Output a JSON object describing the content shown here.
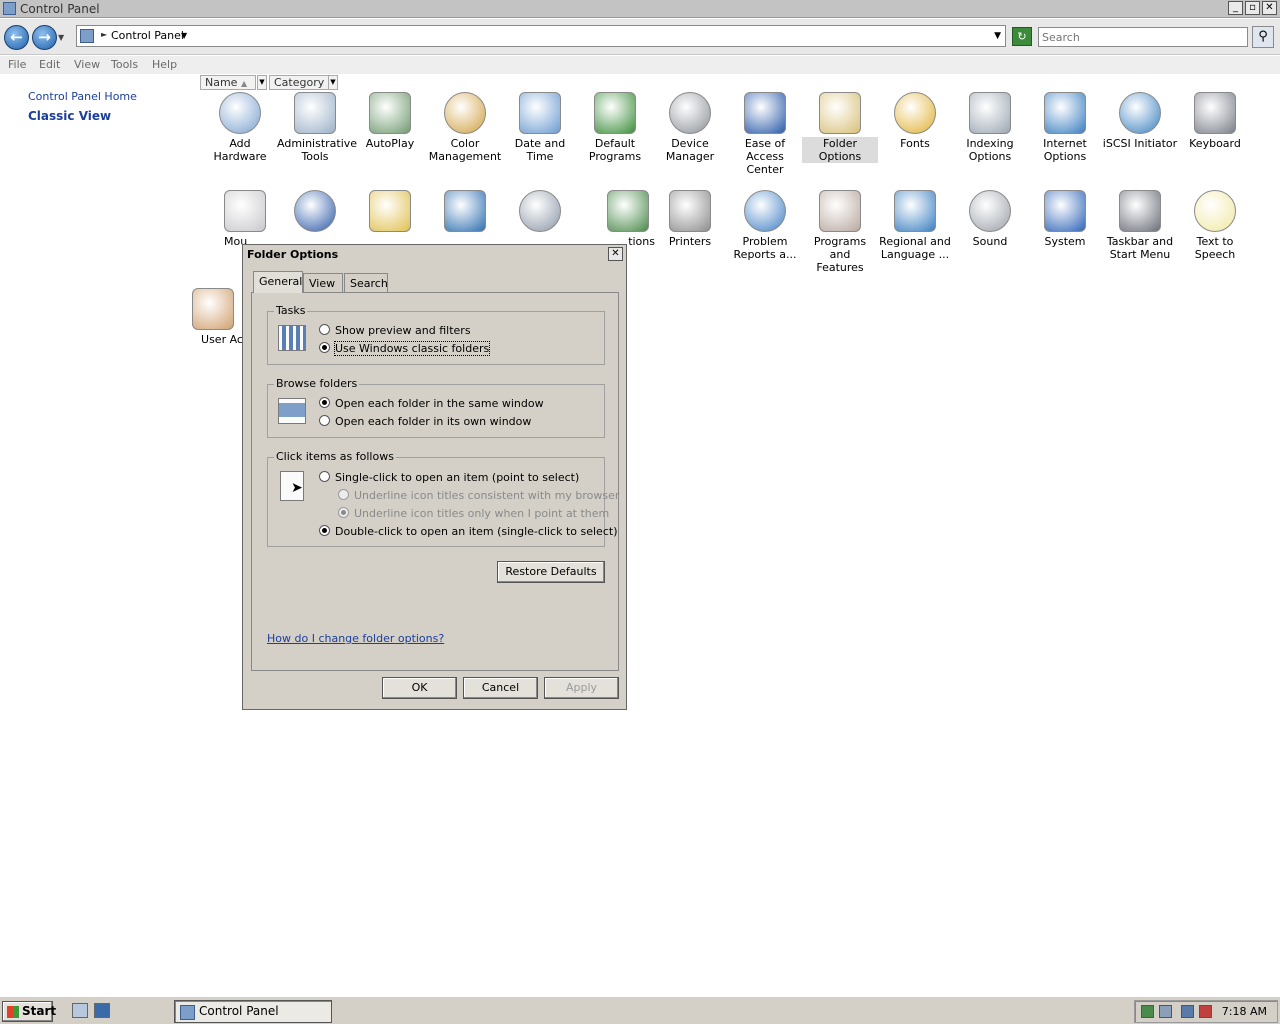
{
  "window": {
    "title": "Control Panel",
    "min": "_",
    "max": "▫",
    "close": "✕"
  },
  "address": {
    "path": "Control Panel",
    "search_placeholder": "Search"
  },
  "menu": [
    "File",
    "Edit",
    "View",
    "Tools",
    "Help"
  ],
  "leftpane": {
    "home": "Control Panel Home",
    "classic": "Classic View"
  },
  "columns": {
    "name": "Name",
    "category": "Category"
  },
  "items": [
    {
      "label": "Add Hardware",
      "icon": "add-hardware-icon"
    },
    {
      "label": "Administrative\nTools",
      "icon": "administrative-tools-icon"
    },
    {
      "label": "AutoPlay",
      "icon": "autoplay-icon"
    },
    {
      "label": "Color\nManagement",
      "icon": "color-management-icon"
    },
    {
      "label": "Date and Time",
      "icon": "date-time-icon"
    },
    {
      "label": "Default\nPrograms",
      "icon": "default-programs-icon"
    },
    {
      "label": "Device\nManager",
      "icon": "device-manager-icon"
    },
    {
      "label": "Ease of\nAccess Center",
      "icon": "ease-of-access-icon"
    },
    {
      "label": "Folder Options",
      "icon": "folder-options-icon"
    },
    {
      "label": "Fonts",
      "icon": "fonts-icon"
    },
    {
      "label": "Indexing\nOptions",
      "icon": "indexing-options-icon"
    },
    {
      "label": "Internet\nOptions",
      "icon": "internet-options-icon"
    },
    {
      "label": "iSCSI Initiator",
      "icon": "iscsi-initiator-icon"
    },
    {
      "label": "Keyboard",
      "icon": "keyboard-icon"
    },
    {
      "label": "Mou",
      "icon": "mouse-icon"
    },
    {
      "label": "",
      "icon": "network-icon"
    },
    {
      "label": "",
      "icon": "offline-files-icon"
    },
    {
      "label": "",
      "icon": "personalization-icon"
    },
    {
      "label": "",
      "icon": "phone-modem-icon"
    },
    {
      "label": "tions",
      "icon": "power-options-icon"
    },
    {
      "label": "Printers",
      "icon": "printers-icon"
    },
    {
      "label": "Problem\nReports a...",
      "icon": "problem-reports-icon"
    },
    {
      "label": "Programs and\nFeatures",
      "icon": "programs-features-icon"
    },
    {
      "label": "Regional and\nLanguage ...",
      "icon": "regional-language-icon"
    },
    {
      "label": "Sound",
      "icon": "sound-icon"
    },
    {
      "label": "System",
      "icon": "system-icon"
    },
    {
      "label": "Taskbar and\nStart Menu",
      "icon": "taskbar-start-menu-icon"
    },
    {
      "label": "Text to\nSpeech",
      "icon": "text-to-speech-icon"
    },
    {
      "label": "User Ac",
      "icon": "user-accounts-icon"
    }
  ],
  "dialog": {
    "title": "Folder Options",
    "tabs": [
      "General",
      "View",
      "Search"
    ],
    "tasks": {
      "title": "Tasks",
      "opt1": "Show preview and filters",
      "opt2": "Use Windows classic folders"
    },
    "browse": {
      "title": "Browse folders",
      "opt1": "Open each folder in the same window",
      "opt2": "Open each folder in its own window"
    },
    "click": {
      "title": "Click items as follows",
      "opt1": "Single-click to open an item (point to select)",
      "sub1": "Underline icon titles consistent with my browser",
      "sub2": "Underline icon titles only when I point at them",
      "opt2": "Double-click to open an item (single-click to select)"
    },
    "restore": "Restore Defaults",
    "help_link": "How do I change folder options?",
    "ok": "OK",
    "cancel": "Cancel",
    "apply": "Apply"
  },
  "taskbar": {
    "start": "Start",
    "task": "Control Panel",
    "time": "7:18 AM"
  }
}
